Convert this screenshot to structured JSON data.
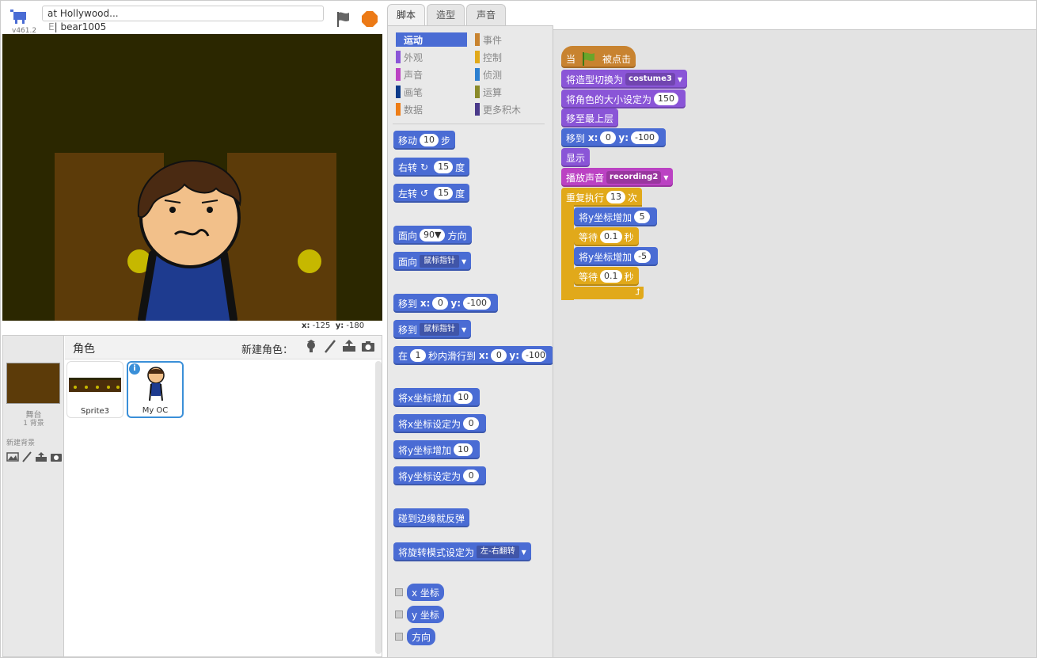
{
  "header": {
    "project_title": "at Hollywood...",
    "author": "bear1005",
    "author_sep": "E",
    "version": "v461.2"
  },
  "stage": {
    "coords_x_label": "x:",
    "coords_x": "-125",
    "coords_y_label": "y:",
    "coords_y": "-180"
  },
  "sprite_pane": {
    "title": "角色",
    "new_sprite_label": "新建角色：",
    "stage_label": "舞台",
    "stage_count": "1 背景",
    "new_backdrop_label": "新建背景",
    "sprites": [
      {
        "name": "Sprite3"
      },
      {
        "name": "My OC"
      }
    ]
  },
  "tabs": [
    "脚本",
    "造型",
    "声音"
  ],
  "categories": [
    {
      "label": "运动",
      "color": "#4a6cd4"
    },
    {
      "label": "外观",
      "color": "#8a55d7"
    },
    {
      "label": "声音",
      "color": "#bb42c3"
    },
    {
      "label": "画笔",
      "color": "#0e9a6c"
    },
    {
      "label": "数据",
      "color": "#ee7d16"
    },
    {
      "label": "事件",
      "color": "#c88330"
    },
    {
      "label": "控制",
      "color": "#e1a91a"
    },
    {
      "label": "侦测",
      "color": "#2ca5e2"
    },
    {
      "label": "运算",
      "color": "#5cb712"
    },
    {
      "label": "更多积木",
      "color": "#632d99"
    }
  ],
  "palette_blocks": {
    "move": {
      "a": "移动",
      "n": "10",
      "b": "步"
    },
    "turn_right": {
      "a": "右转",
      "n": "15",
      "b": "度"
    },
    "turn_left": {
      "a": "左转",
      "n": "15",
      "b": "度"
    },
    "point_dir": {
      "a": "面向",
      "n": "90▼",
      "b": "方向"
    },
    "point_towards": {
      "a": "面向",
      "d": "鼠标指针"
    },
    "goto_xy": {
      "a": "移到",
      "x": "x:",
      "xv": "0",
      "y": "y:",
      "yv": "-100"
    },
    "goto": {
      "a": "移到",
      "d": "鼠标指针"
    },
    "glide": {
      "a": "在",
      "s": "1",
      "b": "秒内滑行到",
      "x": "x:",
      "xv": "0",
      "y": "y:",
      "yv": "-100"
    },
    "change_x": {
      "a": "将x坐标增加",
      "n": "10"
    },
    "set_x": {
      "a": "将x坐标设定为",
      "n": "0"
    },
    "change_y": {
      "a": "将y坐标增加",
      "n": "10"
    },
    "set_y": {
      "a": "将y坐标设定为",
      "n": "0"
    },
    "bounce": {
      "a": "碰到边缘就反弹"
    },
    "rotation_style": {
      "a": "将旋转模式设定为",
      "d": "左-右翻转"
    },
    "reporter_x": "x 坐标",
    "reporter_y": "y 坐标",
    "reporter_dir": "方向"
  },
  "script": {
    "hat": {
      "a": "当",
      "b": "被点击"
    },
    "costume": {
      "a": "将造型切换为",
      "d": "costume3"
    },
    "size": {
      "a": "将角色的大小设定为",
      "n": "150"
    },
    "front": {
      "a": "移至最上层"
    },
    "goto": {
      "a": "移到",
      "x": "x:",
      "xv": "0",
      "y": "y:",
      "yv": "-100"
    },
    "show": {
      "a": "显示"
    },
    "sound": {
      "a": "播放声音",
      "d": "recording2"
    },
    "repeat": {
      "a": "重复执行",
      "n": "13",
      "b": "次"
    },
    "cy1": {
      "a": "将y坐标增加",
      "n": "5"
    },
    "wait1": {
      "a": "等待",
      "n": "0.1",
      "b": "秒"
    },
    "cy2": {
      "a": "将y坐标增加",
      "n": "-5"
    },
    "wait2": {
      "a": "等待",
      "n": "0.1",
      "b": "秒"
    }
  }
}
